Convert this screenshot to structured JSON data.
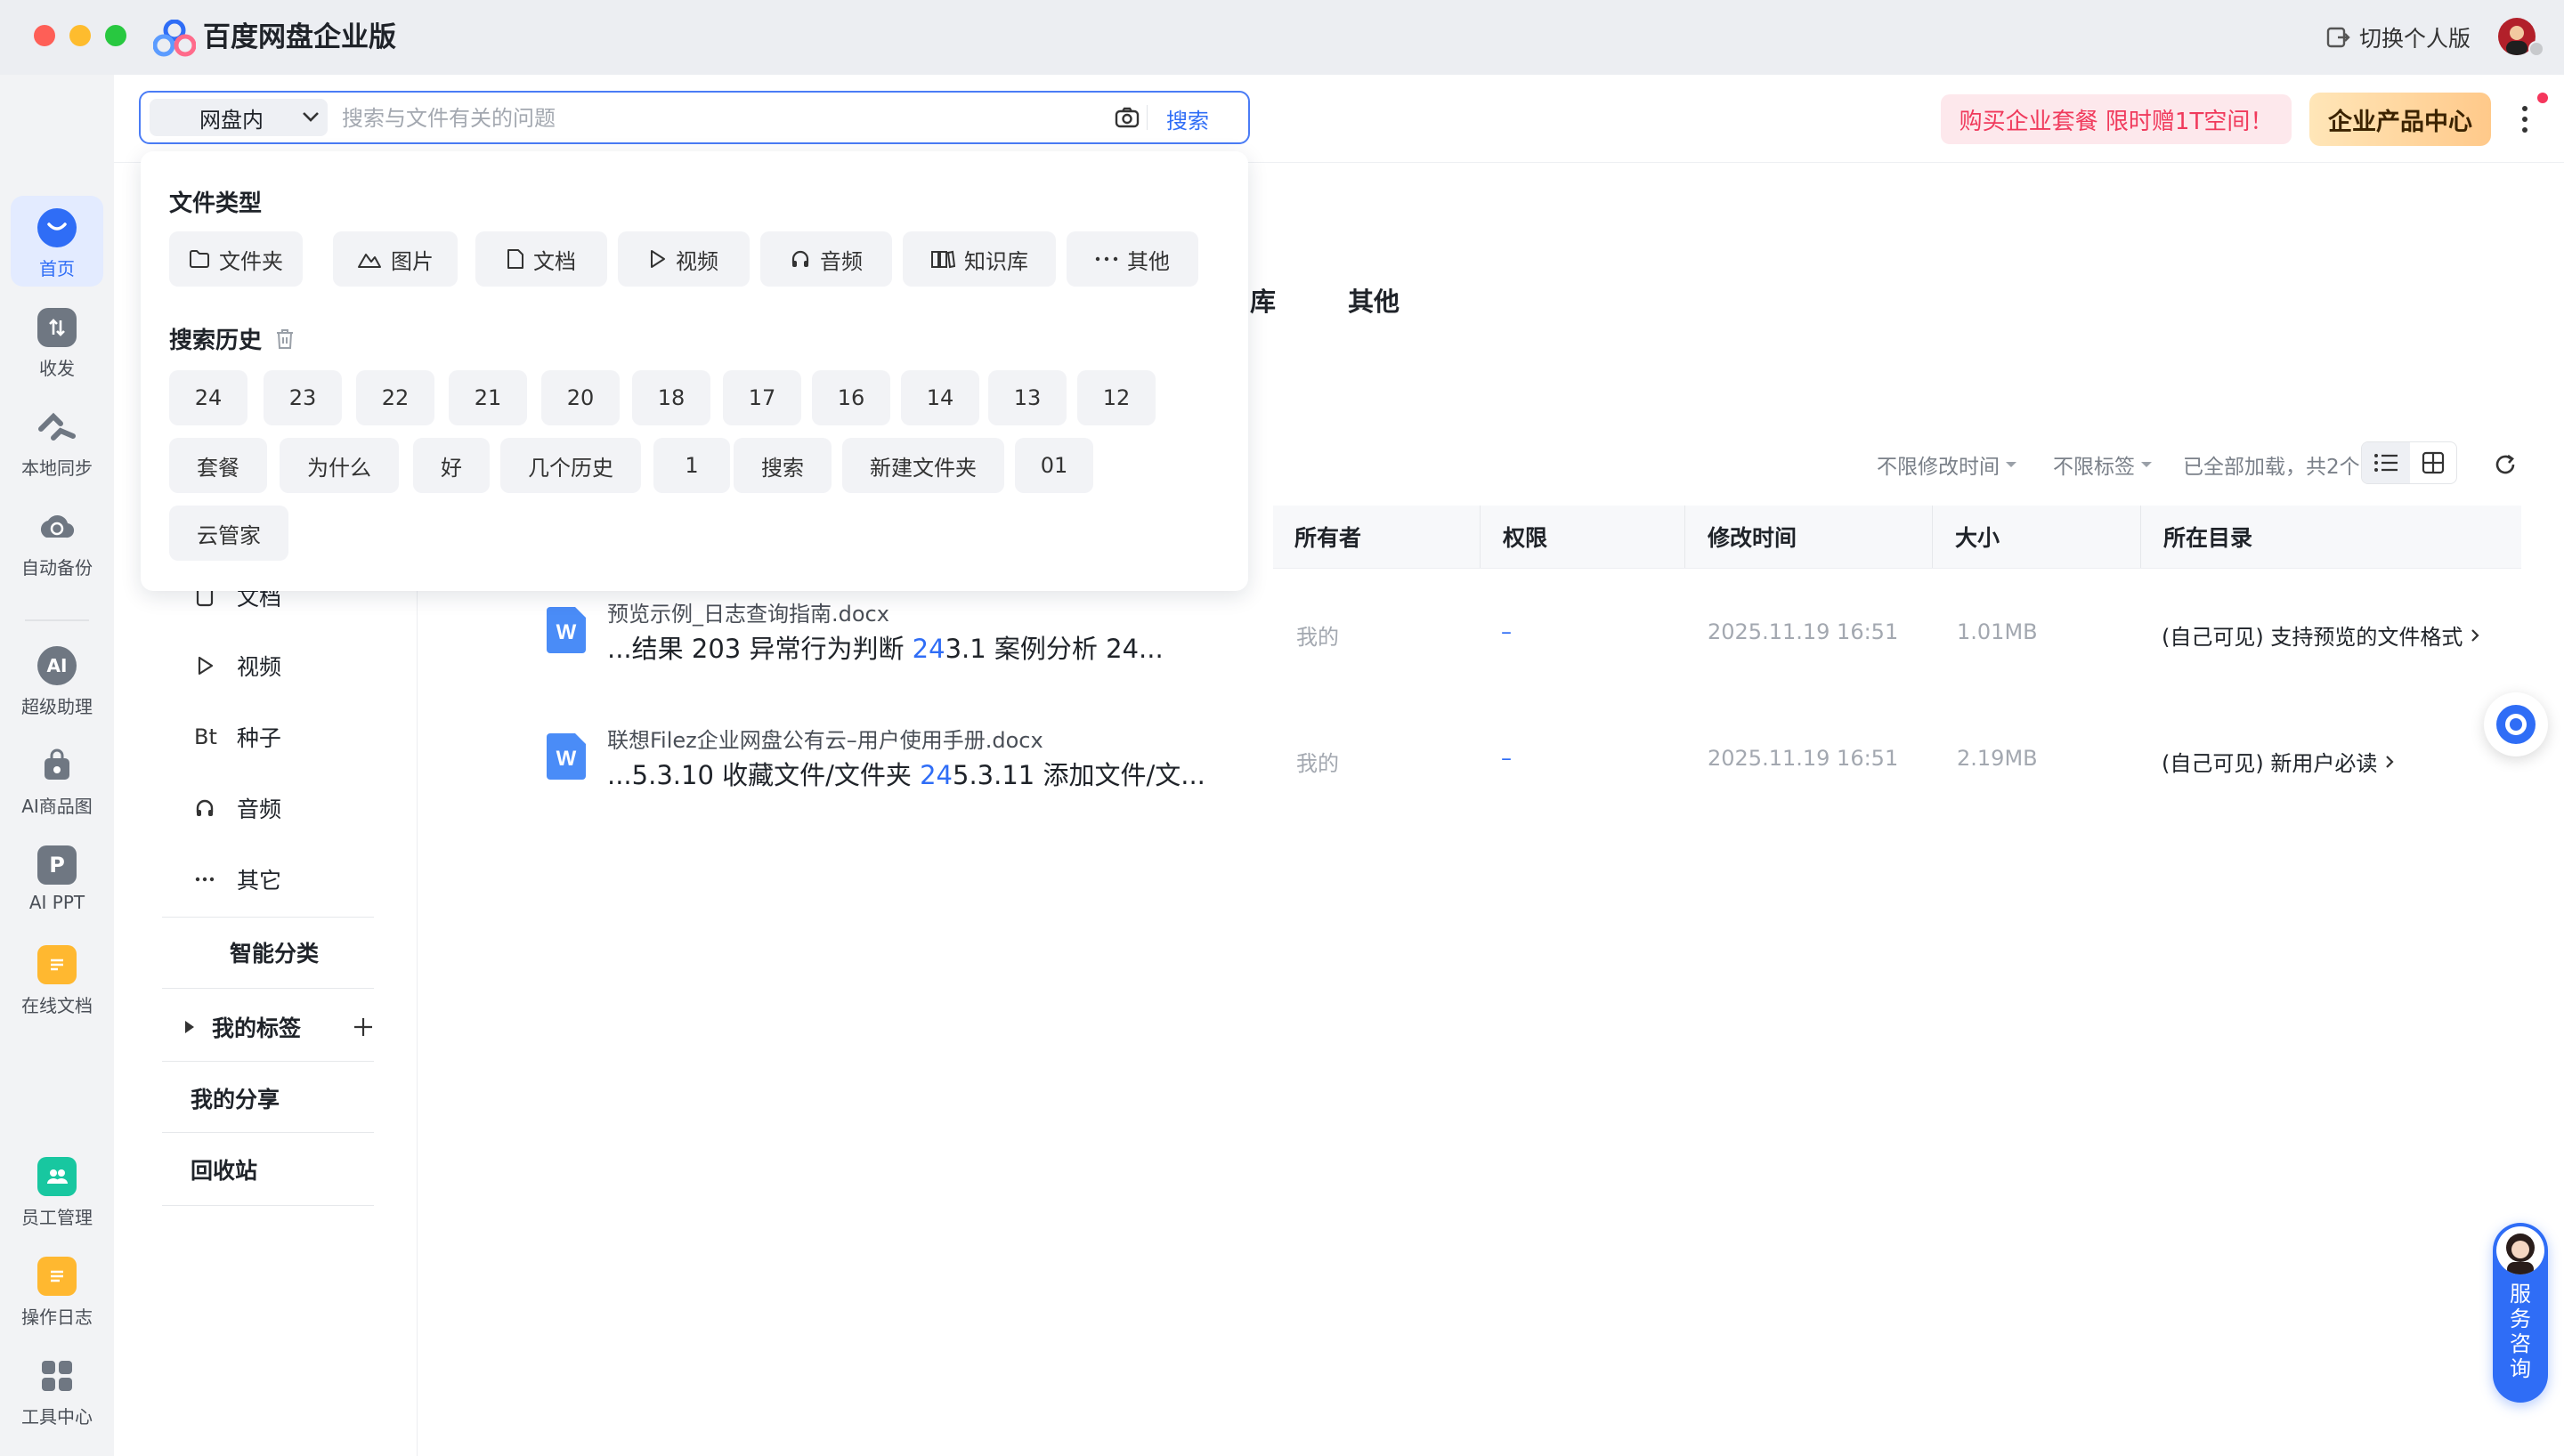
{
  "window": {
    "title": "百度网盘企业版",
    "switch_personal": "切换个人版"
  },
  "rail": {
    "items": [
      {
        "label": "首页"
      },
      {
        "label": "收发"
      },
      {
        "label": "本地同步"
      },
      {
        "label": "自动备份"
      },
      {
        "label": "超级助理"
      },
      {
        "label": "AI商品图"
      },
      {
        "label": "AI PPT"
      },
      {
        "label": "在线文档"
      },
      {
        "label": "员工管理"
      },
      {
        "label": "操作日志"
      },
      {
        "label": "工具中心"
      }
    ],
    "icon_texts": {
      "ai": "AI",
      "ppt": "P"
    }
  },
  "search": {
    "scope": "网盘内",
    "placeholder": "搜索与文件有关的问题",
    "button": "搜索"
  },
  "header": {
    "promo": "购买企业套餐 限时赠1T空间！",
    "product_center": "企业产品中心"
  },
  "dropdown": {
    "file_type_title": "文件类型",
    "file_types": [
      {
        "label": "文件夹"
      },
      {
        "label": "图片"
      },
      {
        "label": "文档"
      },
      {
        "label": "视频"
      },
      {
        "label": "音频"
      },
      {
        "label": "知识库"
      },
      {
        "label": "其他"
      }
    ],
    "history_title": "搜索历史",
    "history_row1": [
      "24",
      "23",
      "22",
      "21",
      "20",
      "18",
      "17",
      "16",
      "14",
      "13",
      "12"
    ],
    "history_row2": [
      "套餐",
      "为什么",
      "好",
      "几个历史",
      "1",
      "搜索",
      "新建文件夹",
      "01"
    ],
    "history_row3": [
      "云管家"
    ]
  },
  "sidebar": {
    "partial_doc": "文档",
    "video": "视频",
    "seed_prefix": "Bt",
    "seed": "种子",
    "audio": "音频",
    "other": "其它",
    "smart_category": "智能分类",
    "my_tags": "我的标签",
    "my_share": "我的分享",
    "recycle": "回收站"
  },
  "main_tabs": {
    "partial": "库",
    "other": "其他"
  },
  "filters": {
    "time": "不限修改时间",
    "tags": "不限标签",
    "status": "已全部加载，共2个"
  },
  "table": {
    "headers": {
      "owner": "所有者",
      "permission": "权限",
      "modified": "修改时间",
      "size": "大小",
      "directory": "所在目录"
    },
    "rows": [
      {
        "name": "预览示例_日志查询指南.docx",
        "snippet_pre": "...结果 203 异常行为判断 ",
        "snippet_hl": "24",
        "snippet_post": "3.1 案例分析 24...",
        "owner": "我的",
        "permission": "–",
        "modified": "2025.11.19 16:51",
        "size": "1.01MB",
        "directory": "(自己可见) 支持预览的文件格式"
      },
      {
        "name": "联想Filez企业网盘公有云–用户使用手册.docx",
        "snippet_pre": "...5.3.10 收藏文件/文件夹 ",
        "snippet_hl": "24",
        "snippet_post": "5.3.11 添加文件/文...",
        "owner": "我的",
        "permission": "–",
        "modified": "2025.11.19 16:51",
        "size": "2.19MB",
        "directory": "(自己可见) 新用户必读"
      }
    ]
  },
  "floating": {
    "service": "服务咨询"
  },
  "colors": {
    "accent": "#2f6df6",
    "promo_text": "#f03a5c",
    "rail_bg": "#f2f3f5"
  }
}
